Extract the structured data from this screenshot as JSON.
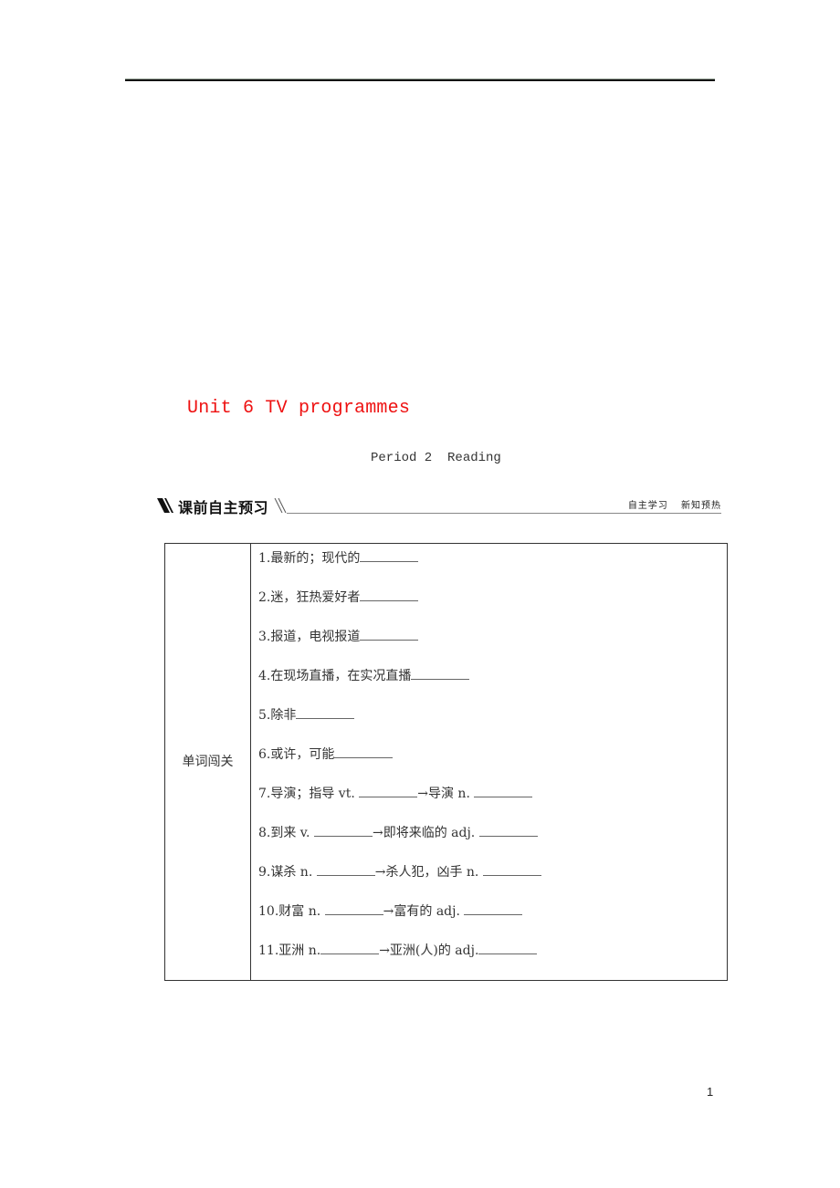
{
  "header": {
    "unit_title": "Unit 6 TV programmes",
    "period_title": "Period 2  Reading"
  },
  "section": {
    "heading": "课前自主预习",
    "tags": [
      "自主学习",
      "新知预热"
    ]
  },
  "vocab_table": {
    "label": "单词闯关",
    "items": [
      {
        "num": "1.",
        "parts": [
          "最新的；现代的",
          "_"
        ]
      },
      {
        "num": "2.",
        "parts": [
          "迷，狂热爱好者",
          "_"
        ]
      },
      {
        "num": "3.",
        "parts": [
          "报道，电视报道",
          "_"
        ]
      },
      {
        "num": "4.",
        "parts": [
          "在现场直播，在实况直播",
          "_"
        ]
      },
      {
        "num": "5.",
        "parts": [
          "除非",
          "_"
        ]
      },
      {
        "num": "6.",
        "parts": [
          "或许，可能",
          "_"
        ]
      },
      {
        "num": "7.",
        "parts": [
          "导演；指导 vt. ",
          "_",
          "→导演 n. ",
          "_"
        ]
      },
      {
        "num": "8.",
        "parts": [
          "到来 v. ",
          "_",
          "→即将来临的 adj. ",
          "_"
        ]
      },
      {
        "num": "9.",
        "parts": [
          "谋杀 n. ",
          "_",
          "→杀人犯，凶手 n. ",
          "_"
        ]
      },
      {
        "num": "10.",
        "parts": [
          "财富 n. ",
          "_",
          "→富有的 adj. ",
          "_"
        ]
      },
      {
        "num": "11.",
        "parts": [
          "亚洲 n.",
          "_",
          "→亚洲(人)的 adj.",
          "_"
        ]
      }
    ]
  },
  "footer": {
    "page_number": "1"
  }
}
